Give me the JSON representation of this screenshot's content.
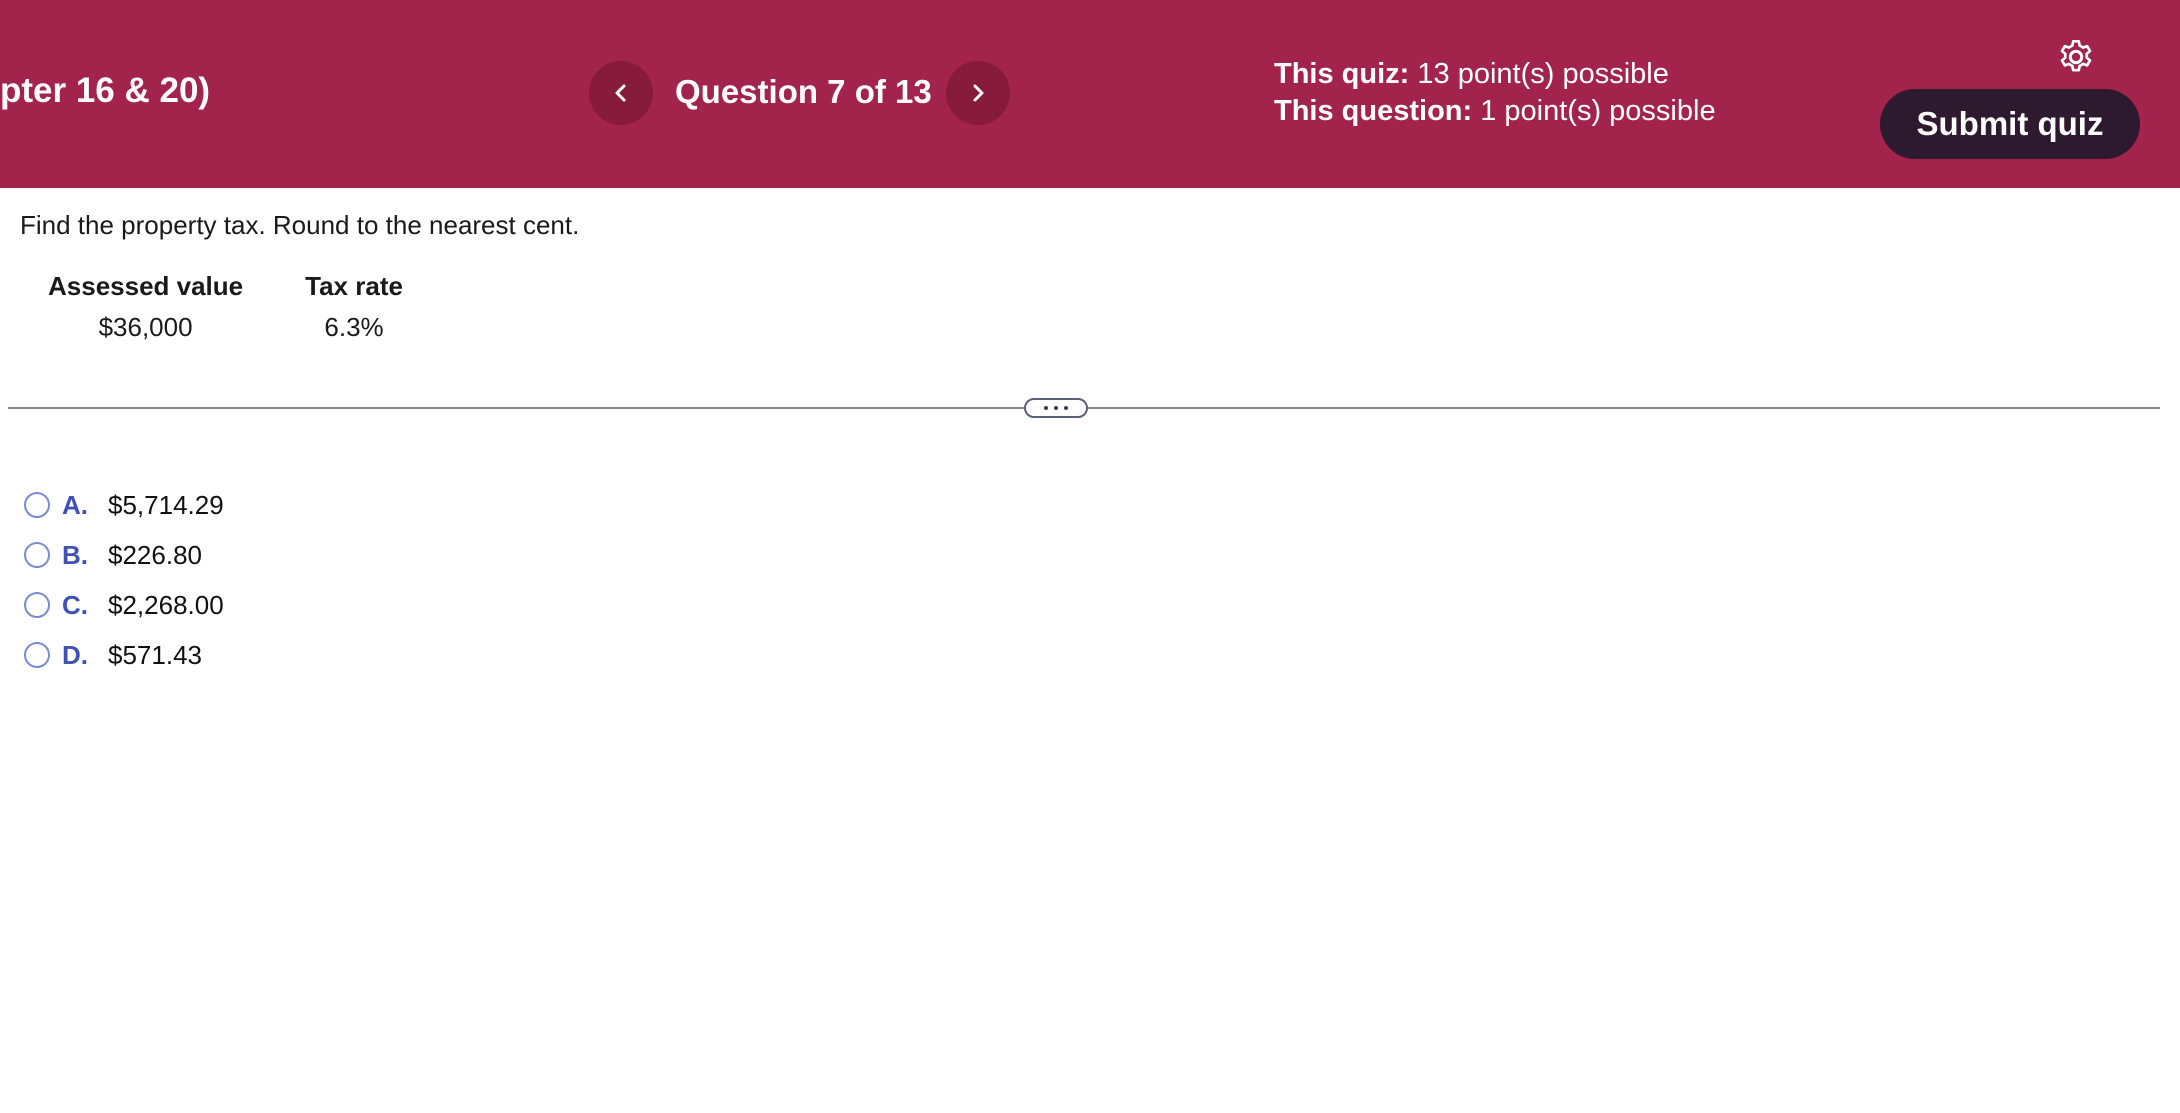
{
  "header": {
    "quiz_title": "pter 16 & 20)",
    "question_counter": "Question 7 of 13",
    "prev_icon": "chevron-left-icon",
    "next_icon": "chevron-right-icon",
    "quiz_points_label": "This quiz:",
    "quiz_points_value": "13 point(s) possible",
    "question_points_label": "This question:",
    "question_points_value": "1 point(s) possible",
    "settings_icon": "gear-icon",
    "submit_label": "Submit quiz",
    "background_color": "#a2234b",
    "submit_color": "#2e1a2e"
  },
  "question": {
    "prompt": "Find the property tax. Round to the nearest cent.",
    "table": {
      "headers": [
        "Assessed value",
        "Tax rate"
      ],
      "row": [
        "$36,000",
        "6.3%"
      ]
    },
    "choices": [
      {
        "letter": "A.",
        "value": "$5,714.29"
      },
      {
        "letter": "B.",
        "value": "$226.80"
      },
      {
        "letter": "C.",
        "value": "$2,268.00"
      },
      {
        "letter": "D.",
        "value": "$571.43"
      }
    ],
    "accent_color": "#3f51b5"
  }
}
